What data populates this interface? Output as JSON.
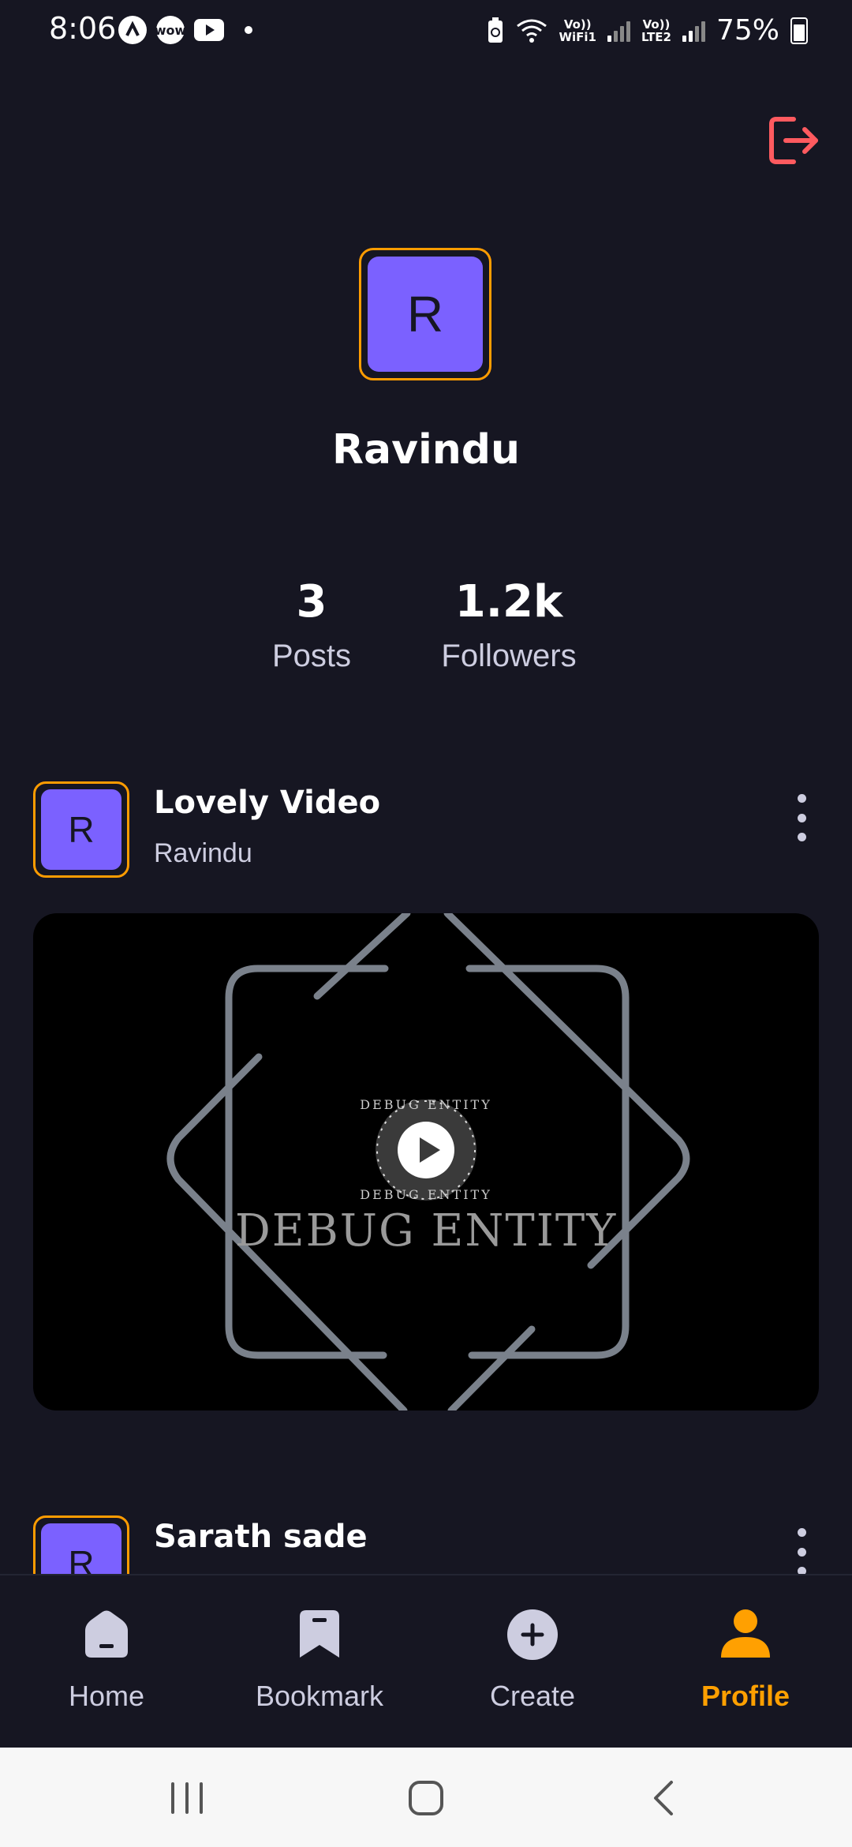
{
  "status_bar": {
    "time": "8:06",
    "app_icon_2": "wow",
    "wifi_label_top": "Vo))",
    "wifi_label_bottom": "WiFi1",
    "lte_label_top": "Vo))",
    "lte_label_bottom": "LTE2",
    "battery": "75%"
  },
  "profile": {
    "avatar_initial": "R",
    "username": "Ravindu",
    "stats": [
      {
        "value": "3",
        "label": "Posts"
      },
      {
        "value": "1.2k",
        "label": "Followers"
      }
    ]
  },
  "posts": [
    {
      "avatar_initial": "R",
      "title": "Lovely Video",
      "author": "Ravindu",
      "thumbnail_text": "DEBUG ENTITY"
    },
    {
      "avatar_initial": "R",
      "title": "Sarath sade"
    }
  ],
  "bottom_nav": [
    {
      "label": "Home",
      "icon": "home-icon"
    },
    {
      "label": "Bookmark",
      "icon": "bookmark-icon"
    },
    {
      "label": "Create",
      "icon": "plus-circle-icon"
    },
    {
      "label": "Profile",
      "icon": "person-icon",
      "active": true
    }
  ],
  "colors": {
    "background": "#161622",
    "accent": "#FFA001",
    "avatar_bg": "#7b61ff",
    "logout": "#ff5a5f"
  }
}
